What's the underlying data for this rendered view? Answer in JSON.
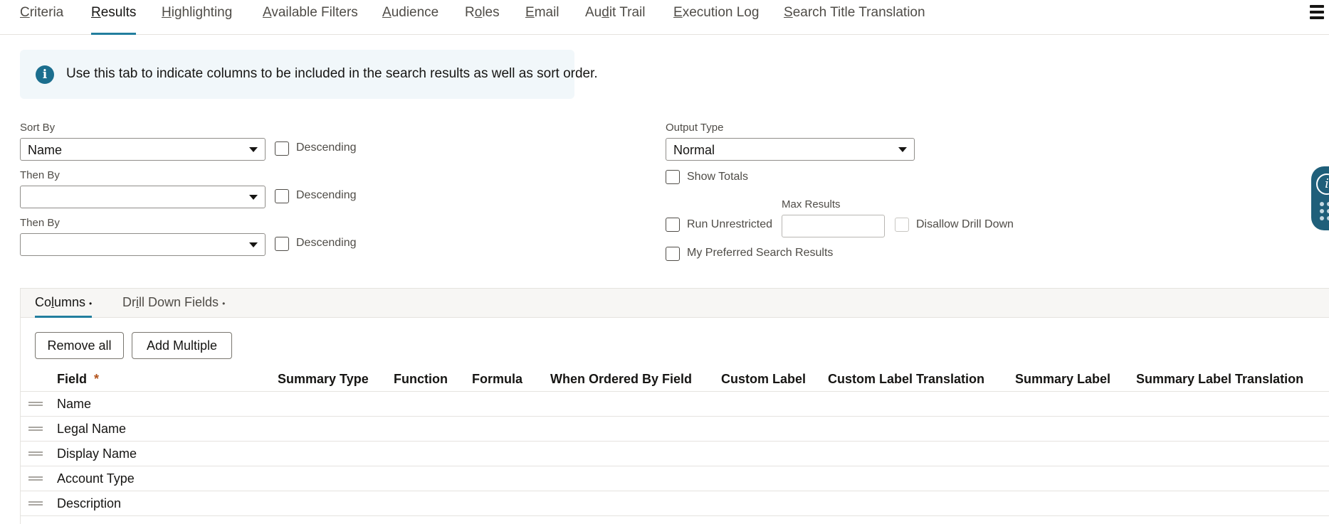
{
  "tabs": [
    {
      "id": "criteria",
      "pre": "",
      "ul": "C",
      "post": "riteria"
    },
    {
      "id": "results",
      "pre": "",
      "ul": "R",
      "post": "esults"
    },
    {
      "id": "highlighting",
      "pre": "",
      "ul": "H",
      "post": "ighlighting"
    },
    {
      "id": "available-filters",
      "pre": "",
      "ul": "A",
      "post": "vailable Filters"
    },
    {
      "id": "audience",
      "pre": "",
      "ul": "A",
      "post": "udience"
    },
    {
      "id": "roles",
      "pre": "R",
      "ul": "o",
      "post": "les"
    },
    {
      "id": "email",
      "pre": "",
      "ul": "E",
      "post": "mail"
    },
    {
      "id": "audit-trail",
      "pre": "Au",
      "ul": "d",
      "post": "it Trail"
    },
    {
      "id": "execution-log",
      "pre": "",
      "ul": "E",
      "post": "xecution Log"
    },
    {
      "id": "search-title-translation",
      "pre": "",
      "ul": "S",
      "post": "earch Title Translation"
    }
  ],
  "active_tab": "Results",
  "banner": {
    "icon": "info-icon",
    "text": "Use this tab to indicate columns to be included in the search results as well as sort order."
  },
  "sort": {
    "sort_by_label": "Sort By",
    "sort_by_value": "Name",
    "then_by_1_label": "Then By",
    "then_by_1_value": "",
    "then_by_2_label": "Then By",
    "then_by_2_value": "",
    "descending_label": "Descending"
  },
  "output": {
    "output_type_label": "Output Type",
    "output_type_value": "Normal",
    "show_totals_label": "Show Totals",
    "run_unrestricted_label": "Run Unrestricted",
    "max_results_label": "Max Results",
    "max_results_value": "",
    "disallow_drill_down_label": "Disallow Drill Down",
    "my_preferred_label": "My Preferred Search Results"
  },
  "subtabs": {
    "columns_pre": "Co",
    "columns_ul": "l",
    "columns_post": "umns",
    "drill_pre": "Dr",
    "drill_ul": "i",
    "drill_post": "ll Down Fields",
    "dot": "•"
  },
  "buttons": {
    "remove_all": "Remove all",
    "add_multiple": "Add Multiple"
  },
  "columns": {
    "headers": {
      "field": "Field",
      "required_mark": "*",
      "summary_type": "Summary Type",
      "function": "Function",
      "formula": "Formula",
      "when_ordered_by_field": "When Ordered By Field",
      "custom_label": "Custom Label",
      "custom_label_translation": "Custom Label Translation",
      "summary_label": "Summary Label",
      "summary_label_translation": "Summary Label Translation"
    },
    "rows": [
      "Name",
      "Legal Name",
      "Display Name",
      "Account Type",
      "Description"
    ]
  },
  "colors": {
    "accent": "#227e9e",
    "info": "#1b6e8e",
    "required": "#b3531c"
  }
}
